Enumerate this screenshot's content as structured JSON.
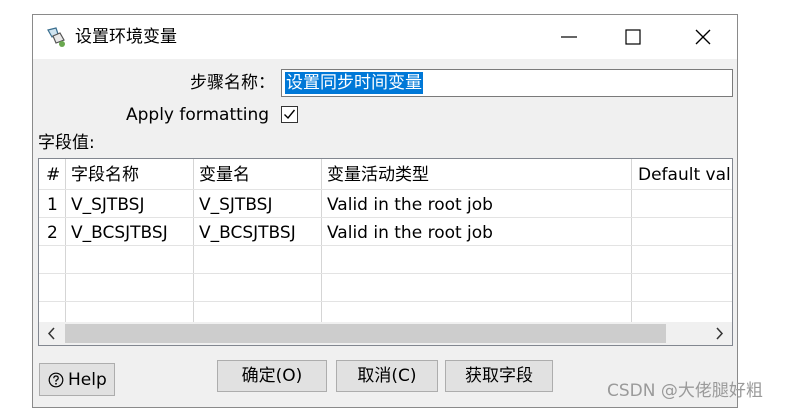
{
  "window": {
    "title": "设置环境变量",
    "icon": "kettle-step-icon"
  },
  "controls": {
    "minimize": "minimize-icon",
    "maximize": "maximize-icon",
    "close": "close-icon"
  },
  "form": {
    "step_name_label": "步骤名称：",
    "step_name_value": "设置同步时间变量",
    "apply_formatting_label": "Apply formatting",
    "apply_formatting_checked": true,
    "fields_label": "字段值:"
  },
  "table": {
    "headers": [
      "#",
      "字段名称",
      "变量名",
      "变量活动类型",
      "Default val"
    ],
    "rows": [
      [
        "1",
        "V_SJTBSJ",
        "V_SJTBSJ",
        "Valid in the root job",
        ""
      ],
      [
        "2",
        "V_BCSJTBSJ",
        "V_BCSJTBSJ",
        "Valid in the root job",
        ""
      ]
    ],
    "scroll_left": "‹",
    "scroll_right": "›"
  },
  "buttons": {
    "help": "Help",
    "ok": "确定(O)",
    "cancel": "取消(C)",
    "get_fields": "获取字段"
  },
  "watermark": "CSDN @大佬腿好粗"
}
